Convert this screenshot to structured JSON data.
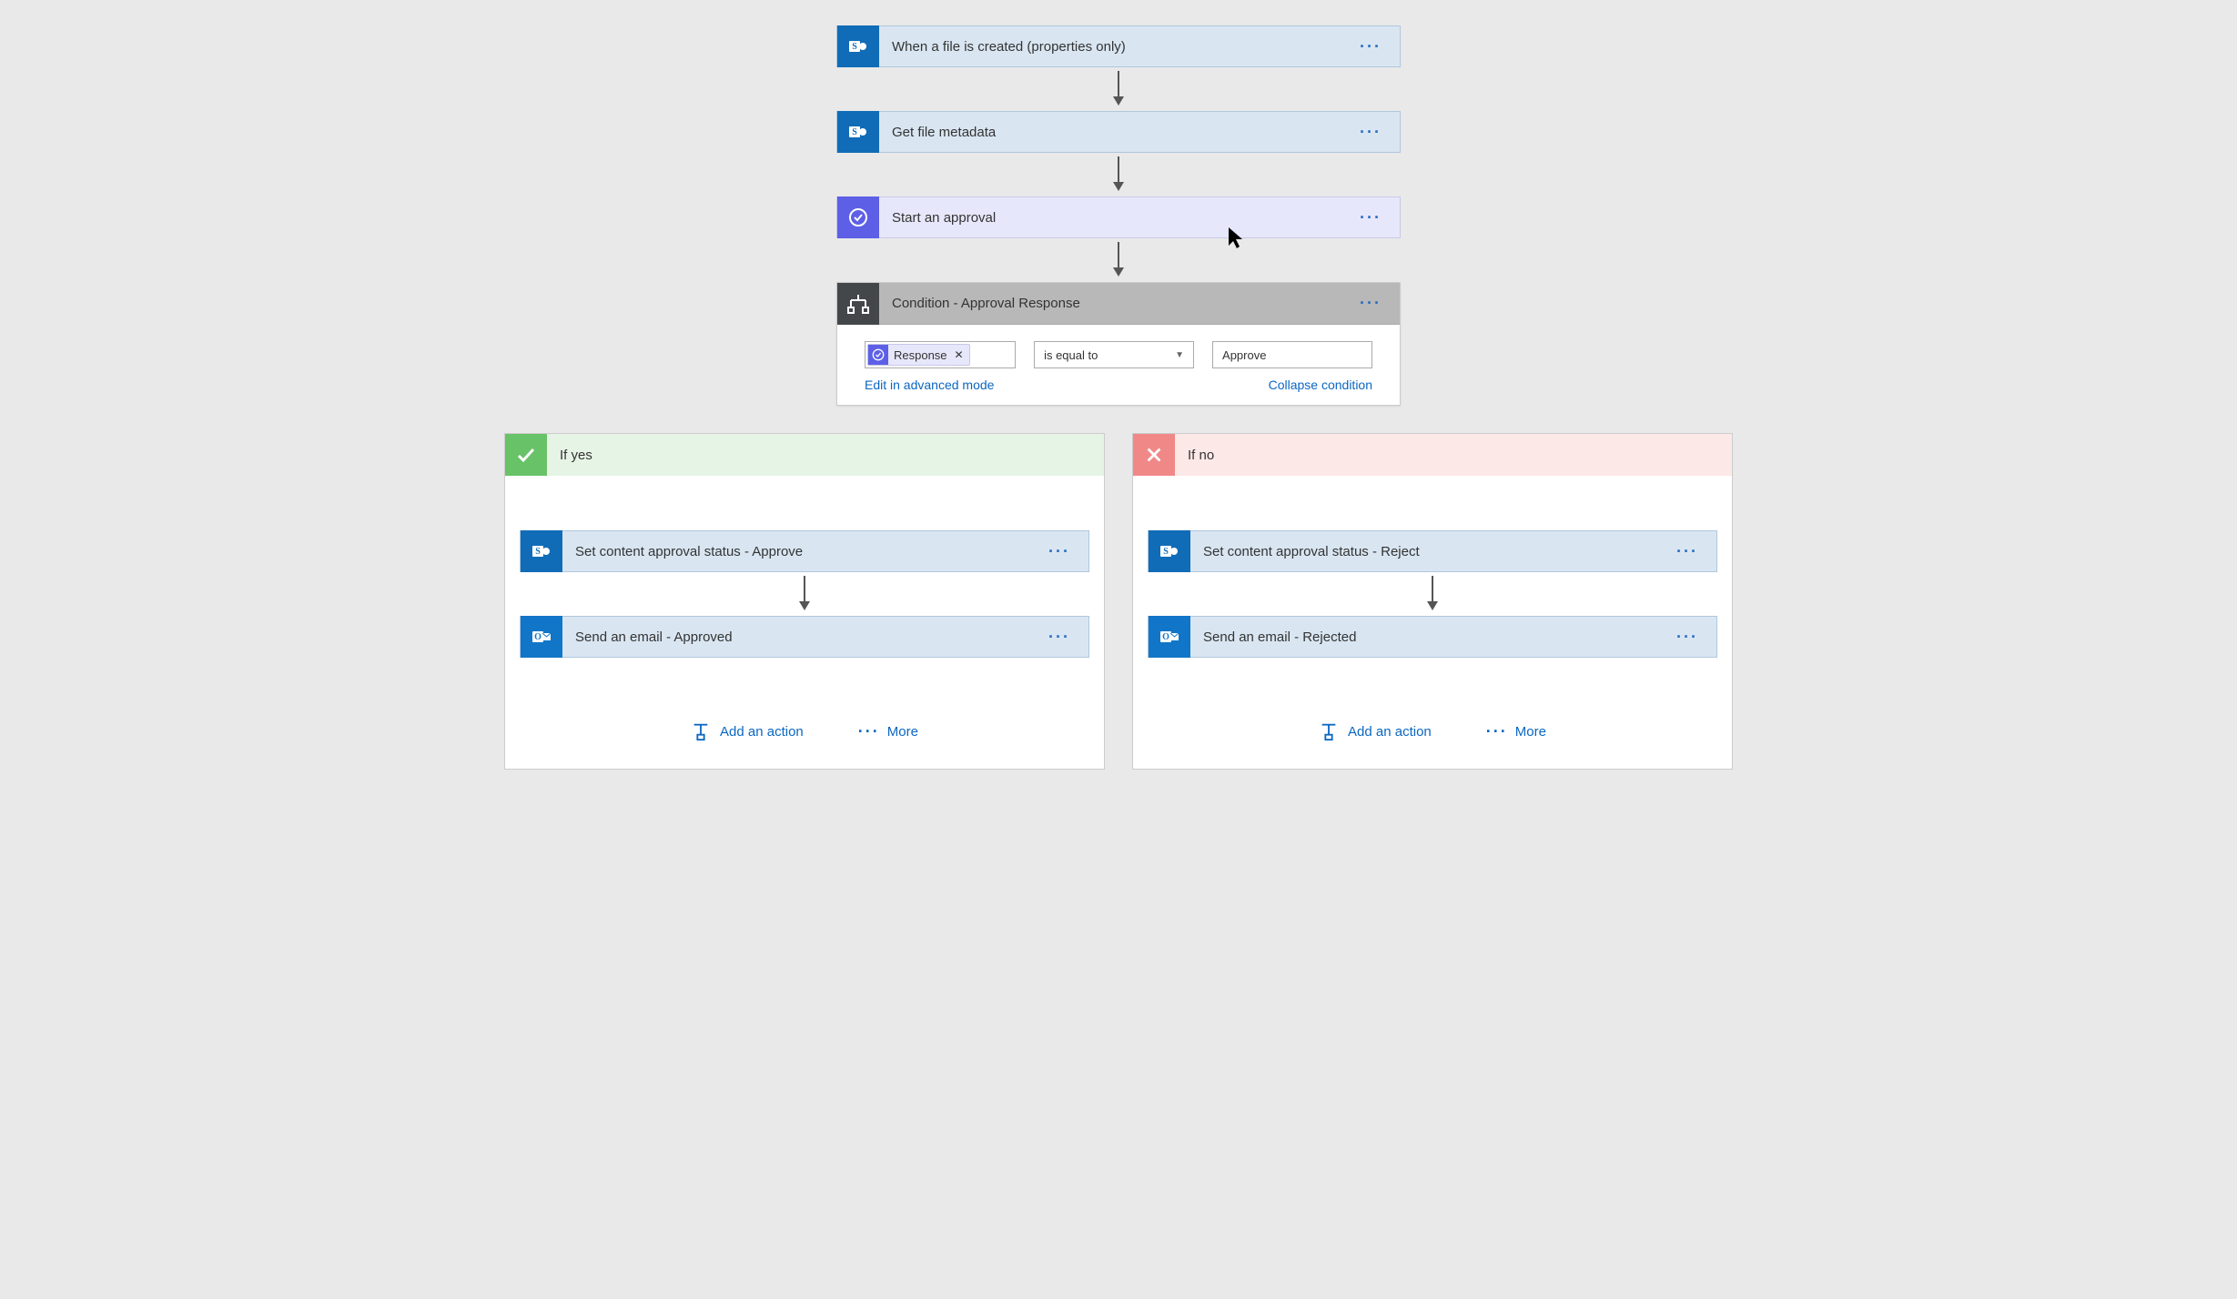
{
  "steps": {
    "trigger": {
      "label": "When a file is created (properties only)",
      "icon": "sharepoint"
    },
    "get_meta": {
      "label": "Get file metadata",
      "icon": "sharepoint"
    },
    "approval": {
      "label": "Start an approval",
      "icon": "approval"
    }
  },
  "condition": {
    "title": "Condition - Approval Response",
    "token": "Response",
    "operator": "is equal to",
    "value": "Approve",
    "edit_link": "Edit in advanced mode",
    "collapse_link": "Collapse condition"
  },
  "branches": {
    "yes": {
      "title": "If yes",
      "steps": [
        {
          "label": "Set content approval status - Approve",
          "icon": "sharepoint"
        },
        {
          "label": "Send an email - Approved",
          "icon": "outlook"
        }
      ],
      "add_action": "Add an action",
      "more": "More"
    },
    "no": {
      "title": "If no",
      "steps": [
        {
          "label": "Set content approval status - Reject",
          "icon": "sharepoint"
        },
        {
          "label": "Send an email - Rejected",
          "icon": "outlook"
        }
      ],
      "add_action": "Add an action",
      "more": "More"
    }
  }
}
